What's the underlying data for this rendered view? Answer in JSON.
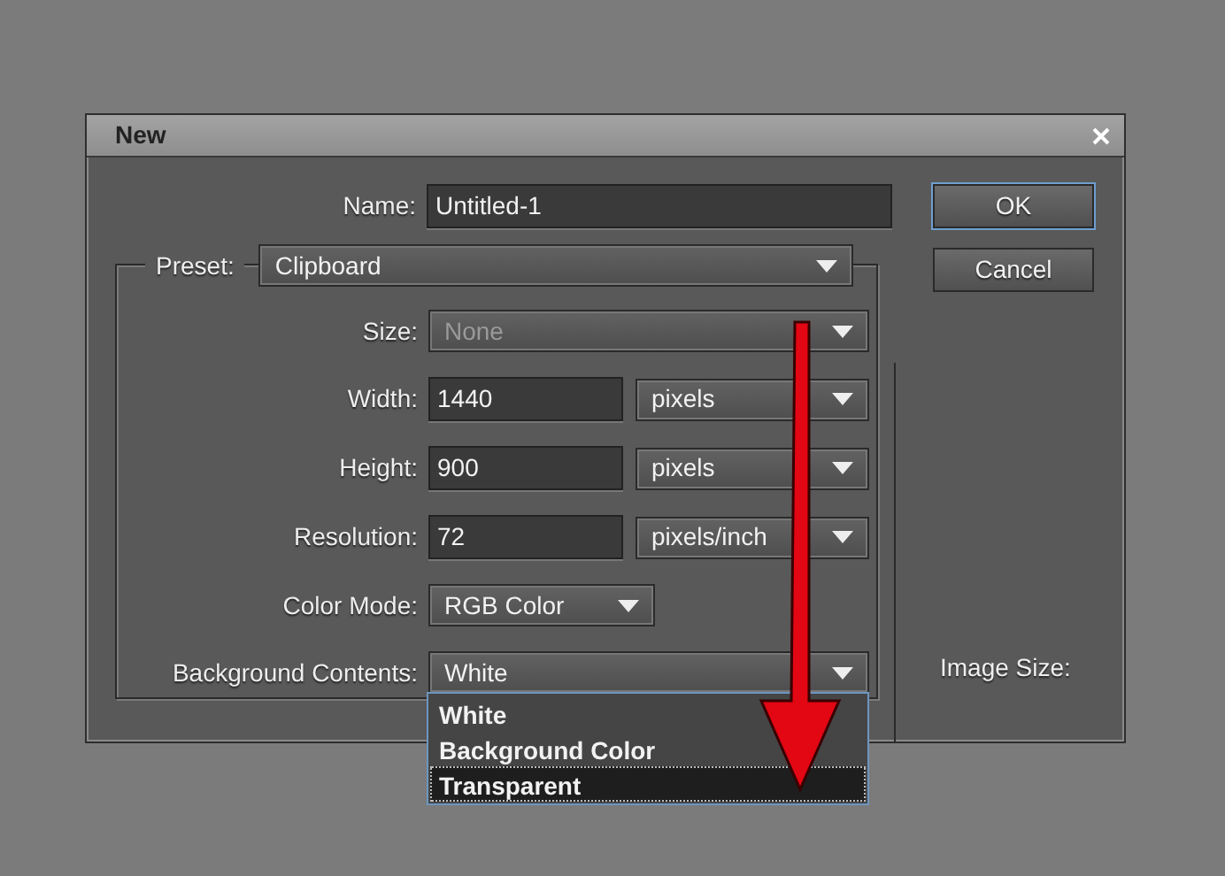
{
  "window": {
    "title": "New"
  },
  "name_field": {
    "label": "Name:",
    "value": "Untitled-1"
  },
  "preset": {
    "label": "Preset:",
    "value": "Clipboard"
  },
  "fields": [
    {
      "kind": "select",
      "label": "Size:",
      "value": "None",
      "disabled": true
    },
    {
      "kind": "number",
      "label": "Width:",
      "value": "1440",
      "unit": "pixels"
    },
    {
      "kind": "number",
      "label": "Height:",
      "value": "900",
      "unit": "pixels"
    },
    {
      "kind": "number",
      "label": "Resolution:",
      "value": "72",
      "unit": "pixels/inch"
    },
    {
      "kind": "short-select",
      "label": "Color Mode:",
      "value": "RGB Color",
      "disabled": false
    },
    {
      "kind": "select",
      "label": "Background Contents:",
      "value": "White",
      "disabled": false
    }
  ],
  "dropdown_options": [
    {
      "label": "White",
      "selected": false
    },
    {
      "label": "Background Color",
      "selected": false
    },
    {
      "label": "Transparent",
      "selected": true
    }
  ],
  "buttons": [
    {
      "label": "OK",
      "default": true
    },
    {
      "label": "Cancel",
      "default": false
    }
  ],
  "image_size": {
    "label": "Image Size:"
  }
}
